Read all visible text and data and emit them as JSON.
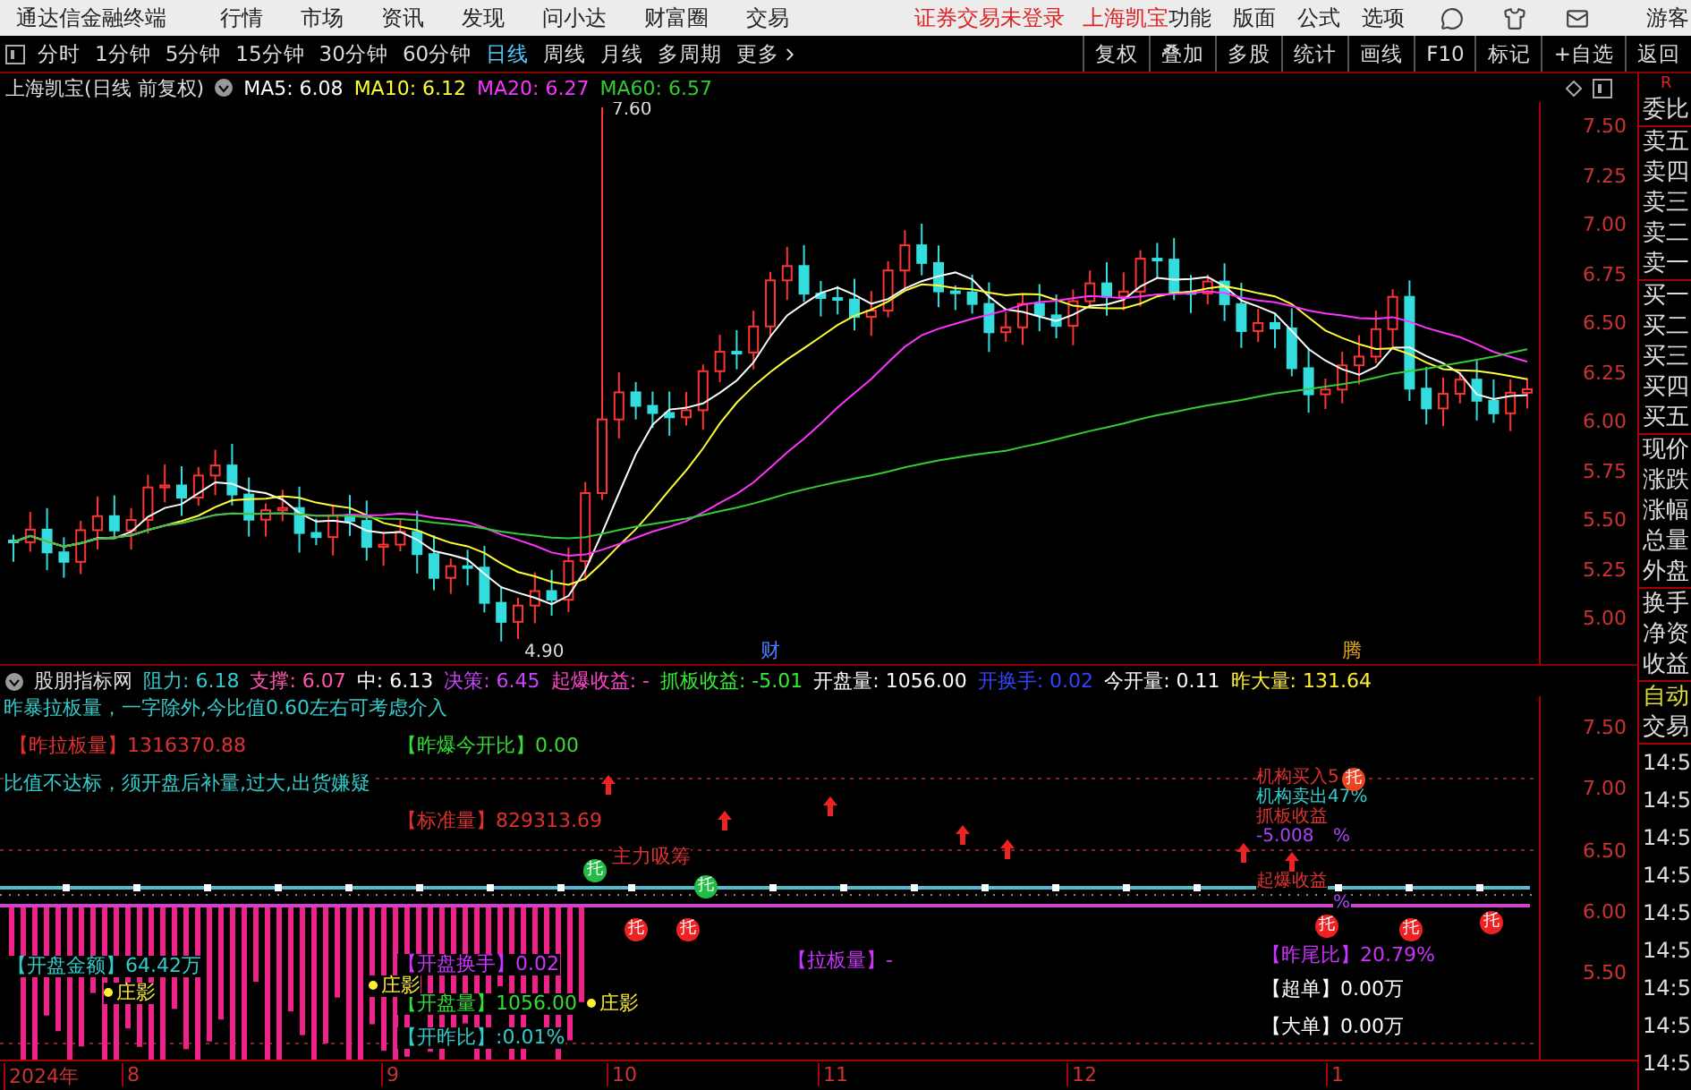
{
  "menu_bar": {
    "app_title": "通达信金融终端",
    "menus": [
      "行情",
      "市场",
      "资讯",
      "发现",
      "问小达",
      "财富圈",
      "交易"
    ],
    "notice": "证券交易未登录",
    "stock": "上海凯宝",
    "right_menus": [
      "功能",
      "版面",
      "公式",
      "选项"
    ],
    "user": "游客"
  },
  "toolbar": {
    "periods": [
      {
        "label": "分时",
        "selected": false
      },
      {
        "label": "1分钟",
        "selected": false
      },
      {
        "label": "5分钟",
        "selected": false
      },
      {
        "label": "15分钟",
        "selected": false
      },
      {
        "label": "30分钟",
        "selected": false
      },
      {
        "label": "60分钟",
        "selected": false
      },
      {
        "label": "日线",
        "selected": true
      },
      {
        "label": "周线",
        "selected": false
      },
      {
        "label": "月线",
        "selected": false
      },
      {
        "label": "多周期",
        "selected": false
      }
    ],
    "more": "更多",
    "buttons": [
      "复权",
      "叠加",
      "多股",
      "统计",
      "画线",
      "F10",
      "标记",
      "+自选",
      "返回"
    ]
  },
  "chart": {
    "title": "上海凯宝(日线 前复权)",
    "ma": [
      {
        "label": "MA5: 6.08",
        "color": "#ffffff"
      },
      {
        "label": "MA10: 6.12",
        "color": "#ffff33"
      },
      {
        "label": "MA20: 6.27",
        "color": "#ff33ff"
      },
      {
        "label": "MA60: 6.57",
        "color": "#33cc33"
      }
    ],
    "high_mark": "7.60",
    "low_mark": "4.90",
    "events": [
      {
        "text": "财",
        "color": "#4c7dff"
      },
      {
        "text": "腾",
        "color": "#e0a020"
      }
    ],
    "y_ticks": [
      "7.50",
      "7.25",
      "7.00",
      "6.75",
      "6.50",
      "6.25",
      "6.00",
      "5.75",
      "5.50",
      "5.25",
      "5.00"
    ]
  },
  "indicator": {
    "name": "股朋指标网",
    "values": [
      {
        "text": "阻力: 6.18",
        "color": "#33cccc"
      },
      {
        "text": "支撑: 6.07",
        "color": "#ff55aa"
      },
      {
        "text": "中: 6.13",
        "color": "#ffffff"
      },
      {
        "text": "决策: 6.45",
        "color": "#cc44ff"
      },
      {
        "text": "起爆收益: -",
        "color": "#ff44cc"
      },
      {
        "text": "抓板收益: -5.01",
        "color": "#33ee33"
      },
      {
        "text": "开盘量: 1056.00",
        "color": "#ffffff"
      },
      {
        "text": "开换手: 0.02",
        "color": "#3344ff"
      },
      {
        "text": "今开量: 0.11",
        "color": "#ffffff"
      },
      {
        "text": "昨大量: 131.64",
        "color": "#ffee33"
      }
    ],
    "labels": [
      {
        "kind": "text",
        "text": "昨暴拉板量，一字除外,今比值0.60左右可考虑介入",
        "color": "#33cccc"
      },
      {
        "kind": "text",
        "text": "【昨拉板量】1316370.88",
        "color": "#e03030"
      },
      {
        "kind": "text",
        "text": "【昨爆今开比】0.00",
        "color": "#33dd33"
      },
      {
        "kind": "text",
        "text": "比值不达标，须开盘后补量,过大,出货嫌疑",
        "color": "#33cccc"
      },
      {
        "kind": "text",
        "text": "【标准量】829313.69",
        "color": "#e03030"
      },
      {
        "kind": "text",
        "text": "主力吸筹",
        "color": "#e03030"
      },
      {
        "kind": "text",
        "text": "【开盘金额】64.42万",
        "color": "#33cccc"
      },
      {
        "kind": "text",
        "text": "【开盘换手】0.02",
        "color": "#cc33ff"
      },
      {
        "kind": "text",
        "text": "【开盘量】1056.00",
        "color": "#33dd33"
      },
      {
        "kind": "text",
        "text": "【开昨比】:0.01%",
        "color": "#33cccc"
      },
      {
        "kind": "dot",
        "text": "庄影",
        "color": "#ffee33"
      },
      {
        "kind": "dot",
        "text": "庄影",
        "color": "#ffee33"
      },
      {
        "kind": "dot",
        "text": "庄影",
        "color": "#ffee33"
      },
      {
        "kind": "text",
        "text": "【拉板量】-",
        "color": "#cc33ff"
      },
      {
        "kind": "small",
        "text": "机构买入5",
        "color": "#e03030"
      },
      {
        "kind": "small",
        "text": "机构卖出47%",
        "color": "#33cccc"
      },
      {
        "kind": "small",
        "text": "抓板收益",
        "color": "#e03030"
      },
      {
        "kind": "small",
        "text": "-5.008",
        "color": "#aa44ff"
      },
      {
        "kind": "small",
        "text": "%",
        "color": "#aa44ff"
      },
      {
        "kind": "small",
        "text": "起爆收益",
        "color": "#e03030"
      },
      {
        "kind": "small",
        "text": "%",
        "color": "#aa44ff"
      },
      {
        "kind": "text",
        "text": "【昨尾比】20.79%",
        "color": "#cc33ff"
      },
      {
        "kind": "text",
        "text": "【超单】0.00万",
        "color": "#ffffff"
      },
      {
        "kind": "text",
        "text": "【大单】0.00万",
        "color": "#ffffff"
      },
      {
        "kind": "badge",
        "text": "托",
        "color": "#22bb44"
      },
      {
        "kind": "badge",
        "text": "托",
        "color": "#ee2222"
      },
      {
        "kind": "badge",
        "text": "托",
        "color": "#ee2222"
      },
      {
        "kind": "badge",
        "text": "托",
        "color": "#22bb44"
      },
      {
        "kind": "badge",
        "text": "托",
        "color": "#ee2222"
      },
      {
        "kind": "badge",
        "text": "托",
        "color": "#ee4422"
      },
      {
        "kind": "badge",
        "text": "托",
        "color": "#ee2222"
      },
      {
        "kind": "badge",
        "text": "托",
        "color": "#ee2222"
      }
    ],
    "y_ticks": [
      "7.50",
      "7.00",
      "6.50",
      "6.00",
      "5.50"
    ]
  },
  "x_axis": [
    "2024年",
    "8",
    "9",
    "10",
    "11",
    "12",
    "1"
  ],
  "side_panel": {
    "corner": "R",
    "quote_groups": [
      [
        "委比"
      ],
      [
        "卖五",
        "卖四",
        "卖三",
        "卖二",
        "卖一"
      ],
      [
        "买一",
        "买二",
        "买三",
        "买四",
        "买五"
      ],
      [
        "现价",
        "涨跌",
        "涨幅",
        "总量",
        "外盘"
      ],
      [
        "换手",
        "净资",
        "收益"
      ]
    ],
    "auto": "自动",
    "trade": "交易",
    "times": [
      "14:5",
      "14:5",
      "14:5",
      "14:5",
      "14:5",
      "14:5",
      "14:5",
      "14:5",
      "14:5"
    ]
  }
}
